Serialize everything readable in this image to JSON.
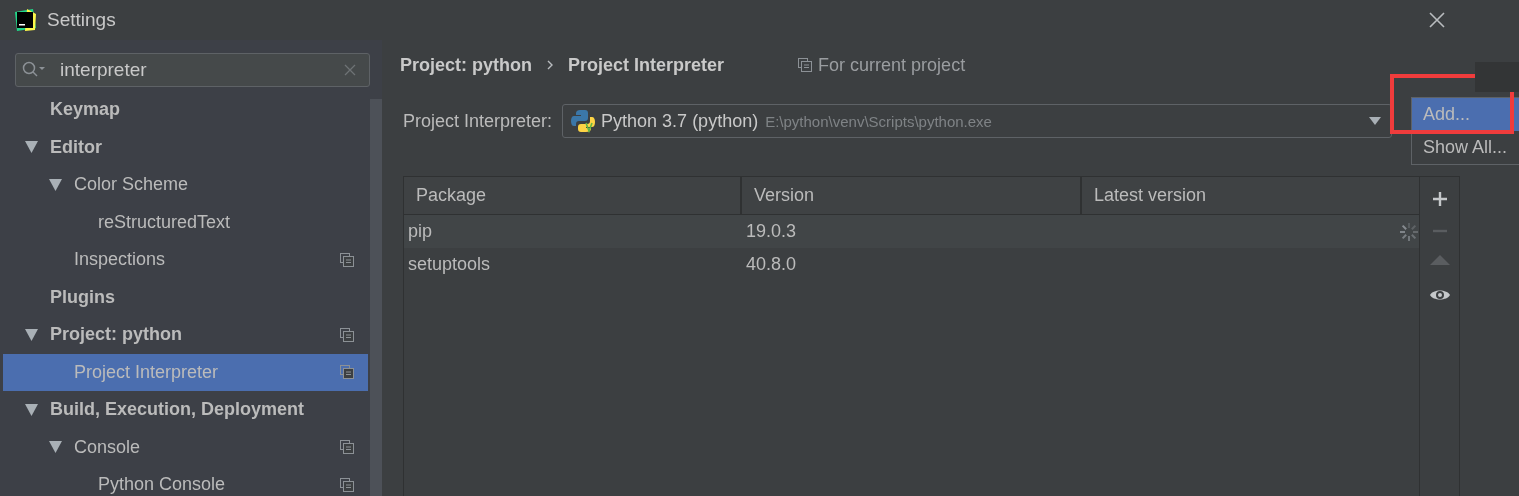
{
  "window": {
    "title": "Settings"
  },
  "search": {
    "value": "interpreter"
  },
  "tree": [
    {
      "label": "Keymap",
      "selected": false,
      "project_scoped": false
    },
    {
      "label": "Editor",
      "selected": false,
      "expanded": true,
      "project_scoped": false,
      "children": [
        {
          "label": "Color Scheme",
          "selected": false,
          "expanded": true,
          "project_scoped": false,
          "children": [
            {
              "label": "reStructuredText",
              "selected": false,
              "project_scoped": false
            }
          ]
        },
        {
          "label": "Inspections",
          "selected": false,
          "project_scoped": true
        }
      ]
    },
    {
      "label": "Plugins",
      "selected": false,
      "project_scoped": false
    },
    {
      "label": "Project: python",
      "selected": false,
      "expanded": true,
      "project_scoped": true,
      "children": [
        {
          "label": "Project Interpreter",
          "selected": true,
          "project_scoped": true
        }
      ]
    },
    {
      "label": "Build, Execution, Deployment",
      "selected": false,
      "expanded": true,
      "project_scoped": false,
      "children": [
        {
          "label": "Console",
          "selected": false,
          "expanded": true,
          "project_scoped": true,
          "children": [
            {
              "label": "Python Console",
              "selected": false,
              "project_scoped": true
            }
          ]
        }
      ]
    }
  ],
  "breadcrumb": [
    "Project: python",
    "Project Interpreter"
  ],
  "scope_note": "For current project",
  "interpreter": {
    "label": "Project Interpreter:",
    "name": "Python 3.7 (python)",
    "path": "E:\\python\\venv\\Scripts\\python.exe"
  },
  "table": {
    "columns": [
      "Package",
      "Version",
      "Latest version"
    ],
    "rows": [
      {
        "package": "pip",
        "version": "19.0.3",
        "latest_loading": true
      },
      {
        "package": "setuptools",
        "version": "40.8.0",
        "latest_loading": false
      }
    ]
  },
  "table_tools": [
    {
      "kind": "add",
      "disabled": false
    },
    {
      "kind": "remove",
      "disabled": true
    },
    {
      "kind": "upgrade",
      "disabled": true
    },
    {
      "kind": "show",
      "disabled": false
    }
  ],
  "menu": [
    {
      "label": "Add...",
      "selected": true,
      "annotated": true
    },
    {
      "label": "Show All...",
      "selected": false,
      "annotated": false
    }
  ]
}
